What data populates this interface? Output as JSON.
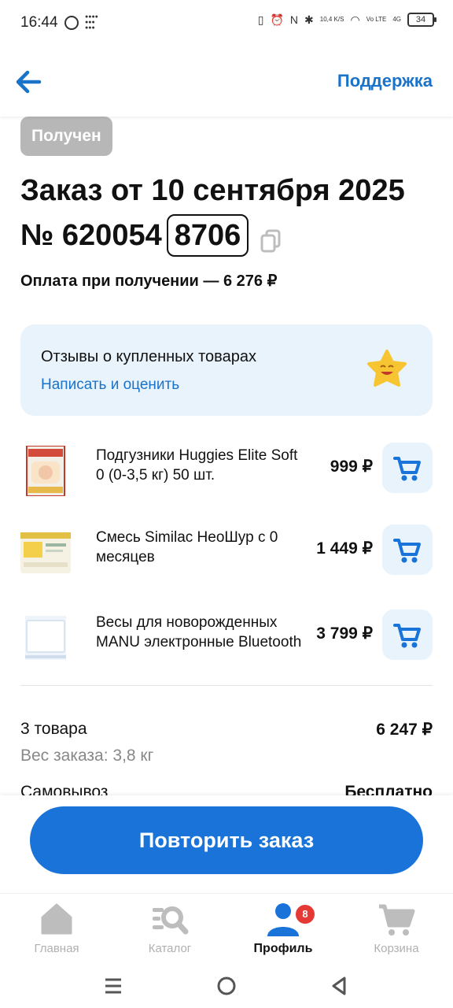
{
  "status_bar": {
    "time": "16:44",
    "net_speed": "10,4 K/S",
    "network": "4G",
    "volte": "Vo LTE",
    "battery": "34"
  },
  "header": {
    "back_icon": "arrow-left-icon",
    "support_label": "Поддержка"
  },
  "order": {
    "status": "Получен",
    "title": "Заказ от 10 сентября 2025",
    "number_prefix": "№ 620054",
    "number_suffix": "8706",
    "payment": "Оплата при получении — 6 276 ₽"
  },
  "review": {
    "title": "Отзывы о купленных товарах",
    "link": "Написать и оценить"
  },
  "products": [
    {
      "name": "Подгузники Huggies Elite Soft 0 (0-3,5 кг) 50 шт.",
      "price": "999 ₽"
    },
    {
      "name": "Смесь Similac НеоШур с 0 месяцев",
      "price": "1 449 ₽"
    },
    {
      "name": "Весы для новорожденных MANU электронные Bluetooth",
      "price": "3 799 ₽"
    }
  ],
  "summary": {
    "items_label": "3 товара",
    "items_total": "6 247 ₽",
    "weight": "Вес заказа: 3,8 кг",
    "pickup_label": "Самовывоз",
    "pickup_value": "Бесплатно"
  },
  "repeat_button": "Повторить заказ",
  "tabs": [
    {
      "label": "Главная",
      "icon": "home-icon"
    },
    {
      "label": "Каталог",
      "icon": "catalog-search-icon"
    },
    {
      "label": "Профиль",
      "icon": "profile-icon",
      "badge": "8",
      "active": true
    },
    {
      "label": "Корзина",
      "icon": "cart-icon"
    }
  ],
  "colors": {
    "accent": "#1a73d8",
    "badge_red": "#e53935",
    "card_bg": "#e8f3fc",
    "status_grey": "#b7b7b7"
  }
}
